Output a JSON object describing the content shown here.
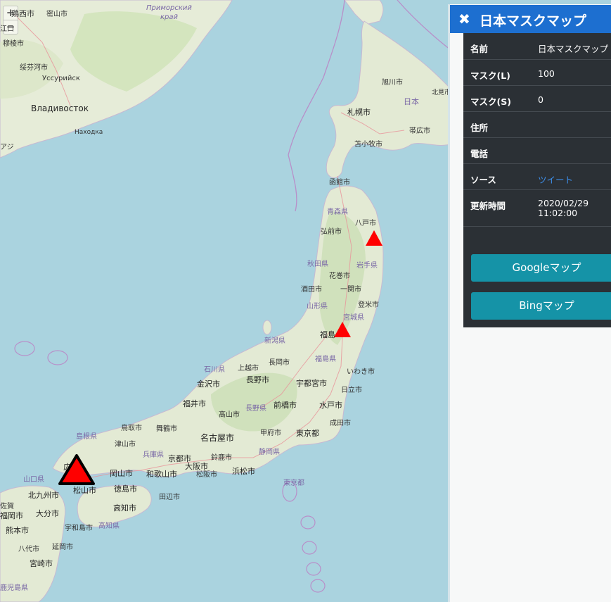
{
  "map": {
    "zoom_in": "+",
    "zoom_out": "−",
    "places": [
      {
        "id": "p1",
        "text": "鶏西市"
      },
      {
        "id": "p2",
        "text": "密山市"
      },
      {
        "id": "p3",
        "text": "Приморский"
      },
      {
        "id": "p4",
        "text": "край"
      },
      {
        "id": "p5",
        "text": "穆棱市"
      },
      {
        "id": "p6",
        "text": "绥芬河市"
      },
      {
        "id": "p7",
        "text": "Уссурийск"
      },
      {
        "id": "p8",
        "text": "Владивосток"
      },
      {
        "id": "p9",
        "text": "Находка"
      },
      {
        "id": "p10",
        "text": "旭川市"
      },
      {
        "id": "p11",
        "text": "北見市"
      },
      {
        "id": "p12",
        "text": "日本"
      },
      {
        "id": "p13",
        "text": "札幌市"
      },
      {
        "id": "p14",
        "text": "帯広市"
      },
      {
        "id": "p15",
        "text": "苫小牧市"
      },
      {
        "id": "p16",
        "text": "函館市"
      },
      {
        "id": "p17",
        "text": "青森県"
      },
      {
        "id": "p18",
        "text": "八戸市"
      },
      {
        "id": "p19",
        "text": "弘前市"
      },
      {
        "id": "p20",
        "text": "秋田県"
      },
      {
        "id": "p21",
        "text": "岩手県"
      },
      {
        "id": "p22",
        "text": "花巻市"
      },
      {
        "id": "p23",
        "text": "酒田市"
      },
      {
        "id": "p24",
        "text": "一関市"
      },
      {
        "id": "p25",
        "text": "山形県"
      },
      {
        "id": "p26",
        "text": "登米市"
      },
      {
        "id": "p27",
        "text": "宮城県"
      },
      {
        "id": "p28",
        "text": "福島"
      },
      {
        "id": "p29",
        "text": "新潟県"
      },
      {
        "id": "p30",
        "text": "福島県"
      },
      {
        "id": "p31",
        "text": "石川県"
      },
      {
        "id": "p32",
        "text": "上越市"
      },
      {
        "id": "p33",
        "text": "長岡市"
      },
      {
        "id": "p34",
        "text": "いわき市"
      },
      {
        "id": "p35",
        "text": "金沢市"
      },
      {
        "id": "p36",
        "text": "長野市"
      },
      {
        "id": "p37",
        "text": "宇都宮市"
      },
      {
        "id": "p38",
        "text": "日立市"
      },
      {
        "id": "p39",
        "text": "福井市"
      },
      {
        "id": "p40",
        "text": "長野県"
      },
      {
        "id": "p41",
        "text": "前橋市"
      },
      {
        "id": "p42",
        "text": "水戸市"
      },
      {
        "id": "p43",
        "text": "高山市"
      },
      {
        "id": "p44",
        "text": "成田市"
      },
      {
        "id": "p45",
        "text": "島根県"
      },
      {
        "id": "p46",
        "text": "鳥取市"
      },
      {
        "id": "p47",
        "text": "舞鶴市"
      },
      {
        "id": "p48",
        "text": "甲府市"
      },
      {
        "id": "p49",
        "text": "東京都"
      },
      {
        "id": "p50",
        "text": "津山市"
      },
      {
        "id": "p51",
        "text": "名古屋市"
      },
      {
        "id": "p52",
        "text": "兵庫県"
      },
      {
        "id": "p53",
        "text": "京都市"
      },
      {
        "id": "p54",
        "text": "静岡県"
      },
      {
        "id": "p55",
        "text": "鈴鹿市"
      },
      {
        "id": "p56",
        "text": "山口県"
      },
      {
        "id": "p57",
        "text": "岡山市"
      },
      {
        "id": "p58",
        "text": "大阪市"
      },
      {
        "id": "p59",
        "text": "浜松市"
      },
      {
        "id": "p60",
        "text": "和歌山市"
      },
      {
        "id": "p61",
        "text": "松阪市"
      },
      {
        "id": "p62",
        "text": "東京都"
      },
      {
        "id": "p63",
        "text": "北九州市"
      },
      {
        "id": "p64",
        "text": "松山市"
      },
      {
        "id": "p65",
        "text": "徳島市"
      },
      {
        "id": "p66",
        "text": "田辺市"
      },
      {
        "id": "p67",
        "text": "大分市"
      },
      {
        "id": "p68",
        "text": "高知市"
      },
      {
        "id": "p69",
        "text": "福岡市"
      },
      {
        "id": "p70",
        "text": "宇和島市"
      },
      {
        "id": "p71",
        "text": "高知県"
      },
      {
        "id": "p72",
        "text": "熊本市"
      },
      {
        "id": "p73",
        "text": "八代市"
      },
      {
        "id": "p74",
        "text": "延岡市"
      },
      {
        "id": "p75",
        "text": "宮崎市"
      },
      {
        "id": "p76",
        "text": "鹿児島県"
      },
      {
        "id": "p77",
        "text": "広島"
      },
      {
        "id": "p78",
        "text": "佐賀"
      },
      {
        "id": "p79",
        "text": "アジ"
      },
      {
        "id": "p80",
        "text": "江口"
      }
    ]
  },
  "panel": {
    "close_icon": "✖",
    "title": "日本マスクマップ",
    "rows": [
      {
        "key": "名前",
        "value": "日本マスクマップ"
      },
      {
        "key": "マスク(L)",
        "value": "100"
      },
      {
        "key": "マスク(S)",
        "value": "0"
      },
      {
        "key": "住所",
        "value": ""
      },
      {
        "key": "電話",
        "value": ""
      },
      {
        "key": "ソース",
        "value": "ツイート"
      },
      {
        "key": "更新時間",
        "value": "2020/02/29",
        "value2": "11:02:00"
      }
    ],
    "google_button": "Googleマップ",
    "bing_button": "Bingマップ"
  },
  "colors": {
    "sea": "#aad3df",
    "land": "#e8eedd",
    "forest": "#c8dfb0",
    "urban": "#e4dcd4",
    "marker": "#ff0000",
    "panel_header": "#1d6fd0",
    "panel_body": "#2b3035",
    "button": "#1593a7",
    "link": "#3d8ee9"
  }
}
